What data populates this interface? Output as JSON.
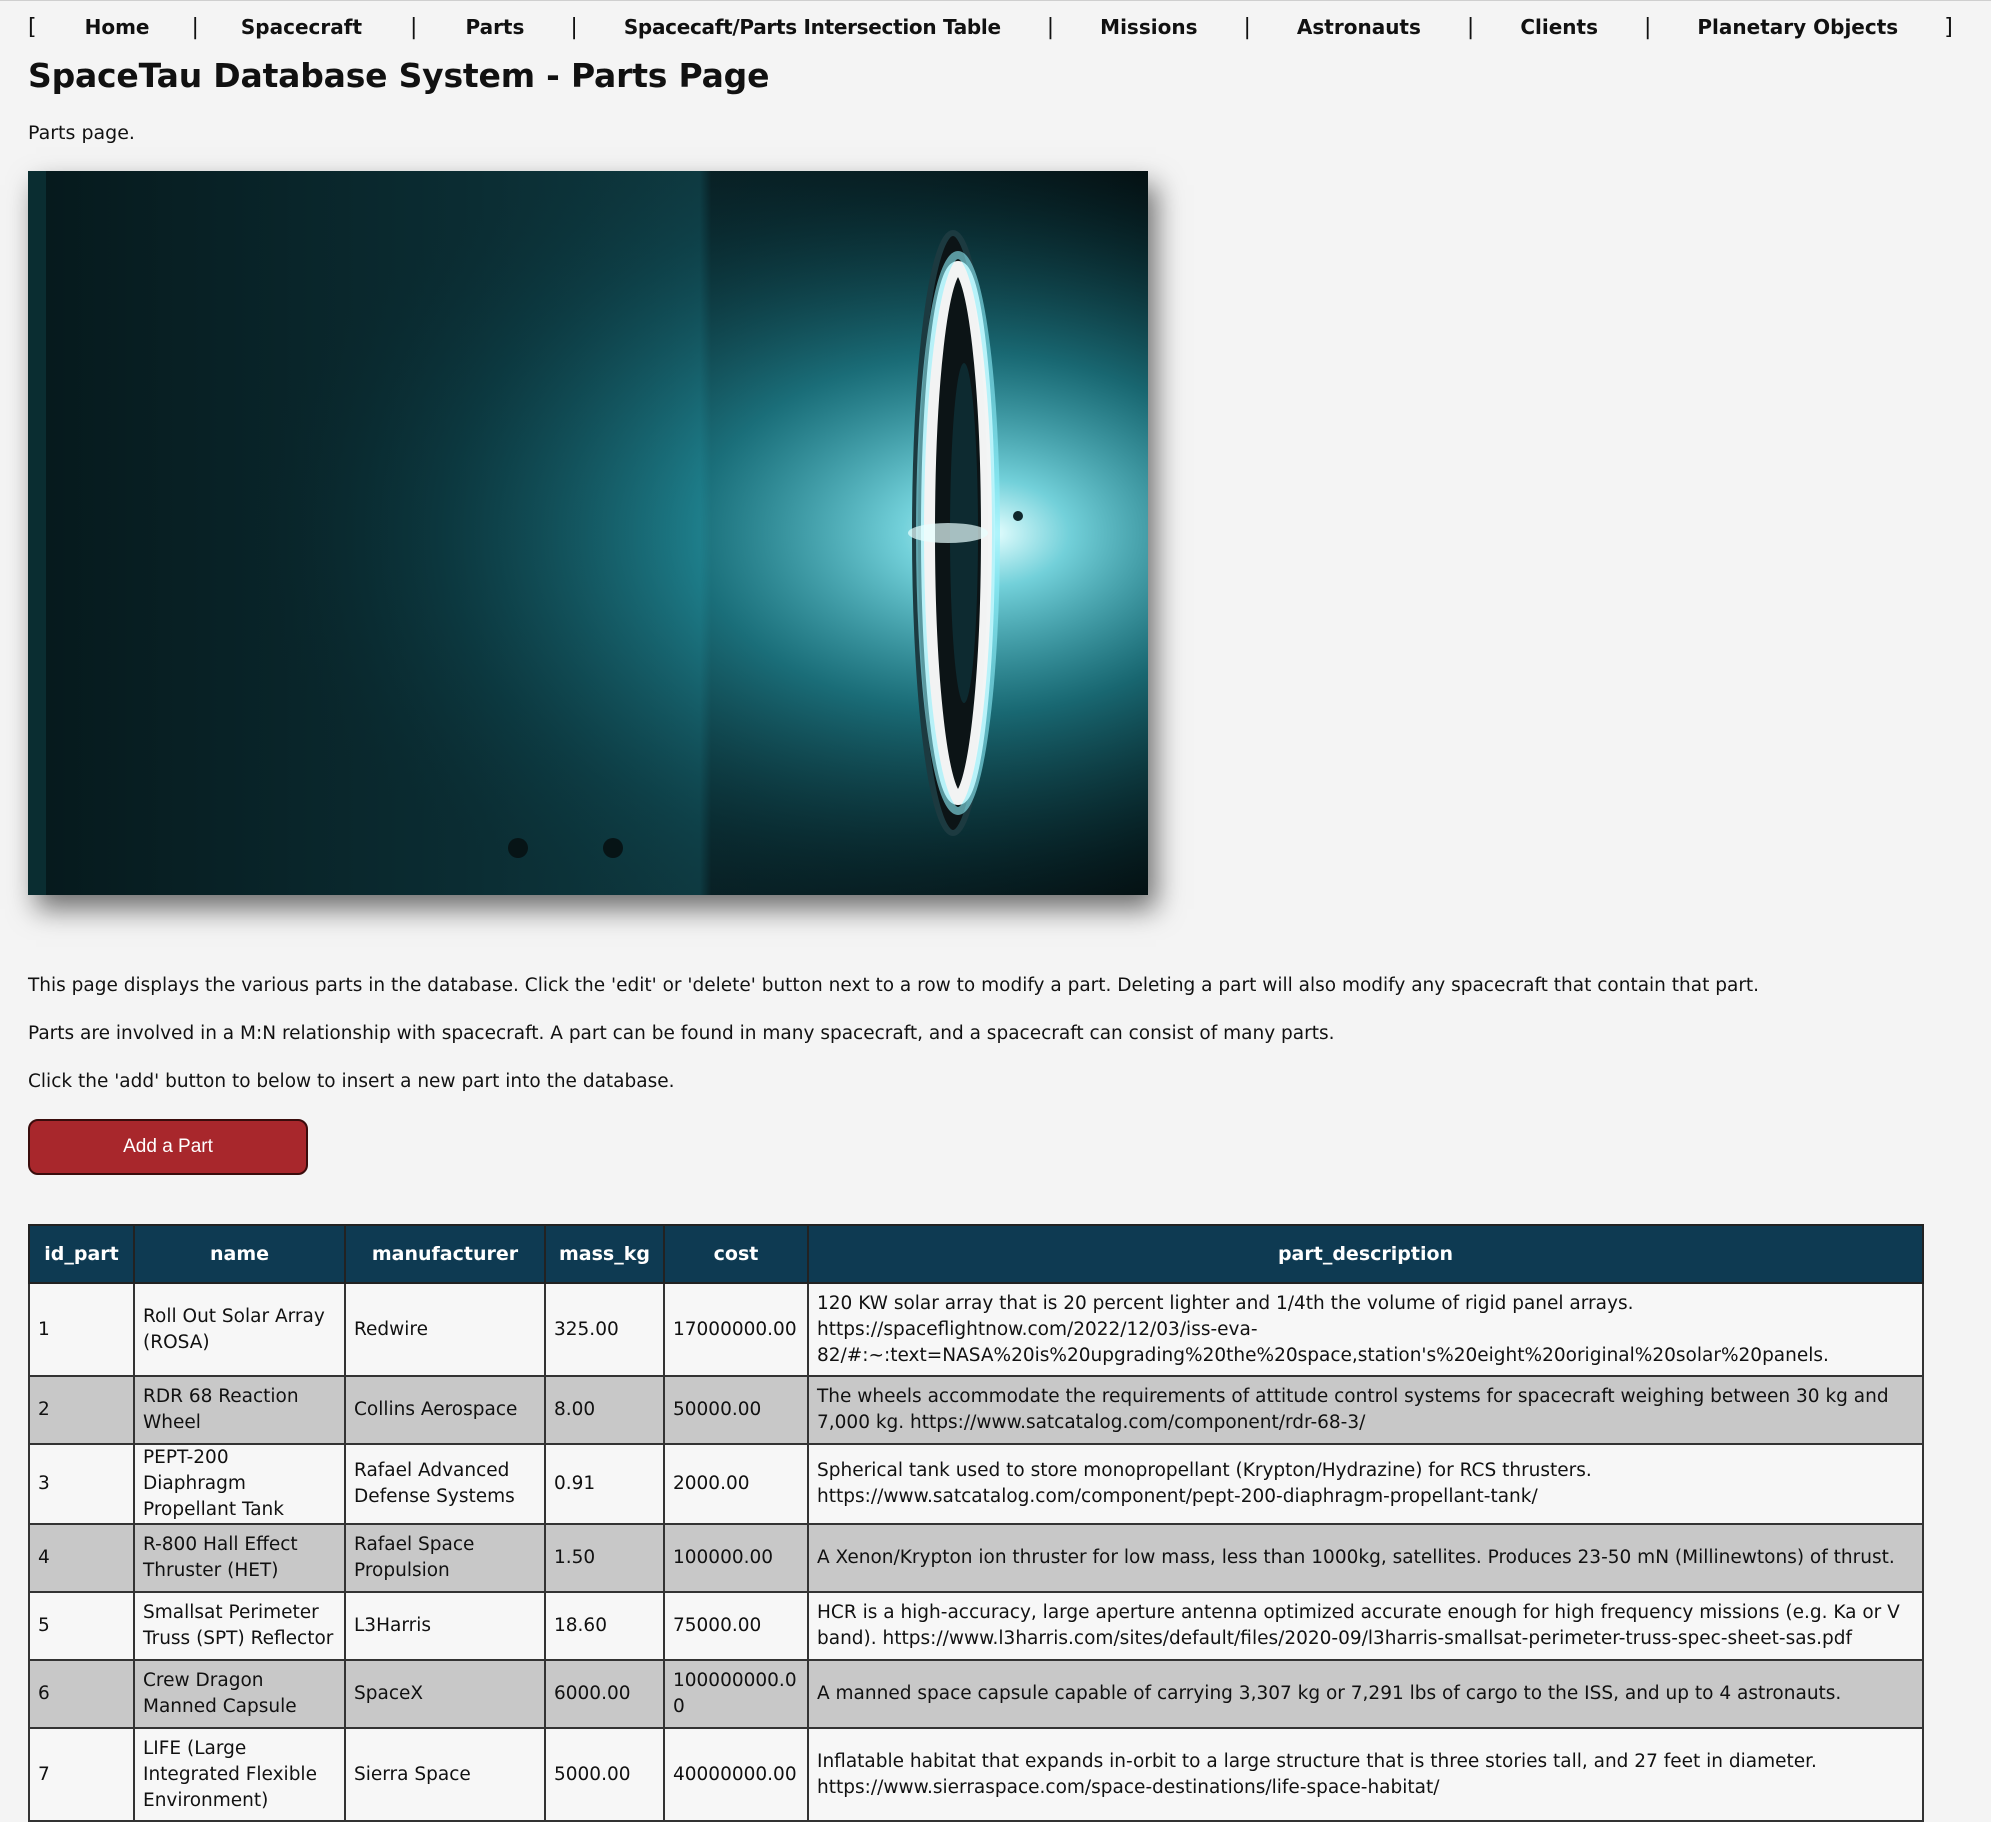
{
  "nav": {
    "open_bracket": "[",
    "close_bracket": "]",
    "separator": "|",
    "items": [
      {
        "label": "Home"
      },
      {
        "label": "Spacecraft"
      },
      {
        "label": "Parts"
      },
      {
        "label": "Spacecaft/Parts Intersection Table"
      },
      {
        "label": "Missions"
      },
      {
        "label": "Astronauts"
      },
      {
        "label": "Clients"
      },
      {
        "label": "Planetary Objects"
      }
    ]
  },
  "page": {
    "title": "SpaceTau Database System - Parts Page",
    "subtitle": "Parts page.",
    "intro1": "This page displays the various parts in the database. Click the 'edit' or 'delete' button next to a row to modify a part. Deleting a part will also modify any spacecraft that contain that part.",
    "intro2": "Parts are involved in a M:N relationship with spacecraft. A part can be found in many spacecraft, and a spacecraft can consist of many parts.",
    "intro3": "Click the 'add' button to below to insert a new part into the database.",
    "add_button": "Add a Part",
    "add_button_color": "#a8272c"
  },
  "table": {
    "header_color": "#0e3a52",
    "columns": [
      "id_part",
      "name",
      "manufacturer",
      "mass_kg",
      "cost",
      "part_description"
    ],
    "rows": [
      {
        "id_part": "1",
        "name": "Roll Out Solar Array (ROSA)",
        "manufacturer": "Redwire",
        "mass_kg": "325.00",
        "cost": "17000000.00",
        "part_description": "120 KW solar array that is 20 percent lighter and 1/4th the volume of rigid panel arrays. https://spaceflightnow.com/2022/12/03/iss-eva-82/#:~:text=NASA%20is%20upgrading%20the%20space,station's%20eight%20original%20solar%20panels."
      },
      {
        "id_part": "2",
        "name": "RDR 68 Reaction Wheel",
        "manufacturer": "Collins Aerospace",
        "mass_kg": "8.00",
        "cost": "50000.00",
        "part_description": "The wheels accommodate the requirements of attitude control systems for spacecraft weighing between 30 kg and 7,000 kg. https://www.satcatalog.com/component/rdr-68-3/"
      },
      {
        "id_part": "3",
        "name": "PEPT-200 Diaphragm Propellant Tank",
        "manufacturer": "Rafael Advanced Defense Systems",
        "mass_kg": "0.91",
        "cost": "2000.00",
        "part_description": "Spherical tank used to store monopropellant (Krypton/Hydrazine) for RCS thrusters. https://www.satcatalog.com/component/pept-200-diaphragm-propellant-tank/"
      },
      {
        "id_part": "4",
        "name": "R-800 Hall Effect Thruster (HET)",
        "manufacturer": "Rafael Space Propulsion",
        "mass_kg": "1.50",
        "cost": "100000.00",
        "part_description": "A Xenon/Krypton ion thruster for low mass, less than 1000kg, satellites. Produces 23-50 mN (Millinewtons) of thrust."
      },
      {
        "id_part": "5",
        "name": "Smallsat Perimeter Truss (SPT) Reflector",
        "manufacturer": "L3Harris",
        "mass_kg": "18.60",
        "cost": "75000.00",
        "part_description": "HCR is a high-accuracy, large aperture antenna optimized accurate enough for high frequency missions (e.g. Ka or V band). https://www.l3harris.com/sites/default/files/2020-09/l3harris-smallsat-perimeter-truss-spec-sheet-sas.pdf"
      },
      {
        "id_part": "6",
        "name": "Crew Dragon Manned Capsule",
        "manufacturer": "SpaceX",
        "mass_kg": "6000.00",
        "cost": "100000000.00",
        "part_description": "A manned space capsule capable of carrying 3,307 kg or 7,291 lbs of cargo to the ISS, and up to 4 astronauts."
      },
      {
        "id_part": "7",
        "name": "LIFE (Large Integrated Flexible Environment)",
        "manufacturer": "Sierra Space",
        "mass_kg": "5000.00",
        "cost": "40000000.00",
        "part_description": "Inflatable habitat that expands in-orbit to a large structure that is three stories tall, and 27 feet in diameter. https://www.sierraspace.com/space-destinations/life-space-habitat/"
      }
    ]
  }
}
